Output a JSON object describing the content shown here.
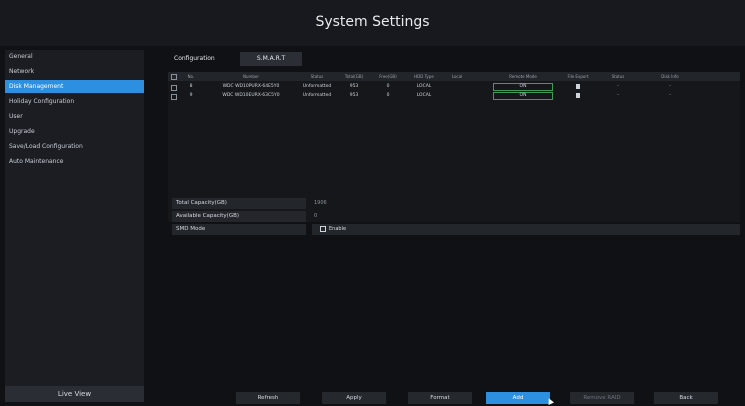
{
  "window": {
    "title": "System Settings"
  },
  "sidebar": {
    "items": [
      {
        "label": "General",
        "active": false
      },
      {
        "label": "Network",
        "active": false
      },
      {
        "label": "Disk Management",
        "active": true
      },
      {
        "label": "Holiday Configuration",
        "active": false
      },
      {
        "label": "User",
        "active": false
      },
      {
        "label": "Upgrade",
        "active": false
      },
      {
        "label": "Save/Load Configuration",
        "active": false
      },
      {
        "label": "Auto Maintenance",
        "active": false
      }
    ],
    "live_view_label": "Live View"
  },
  "tabs": [
    {
      "label": "Configuration"
    },
    {
      "label": "S.M.A.R.T"
    }
  ],
  "disk_table": {
    "headers": [
      "No.",
      "Number",
      "Status",
      "Total(GB)",
      "Free(GB)",
      "HDD Type",
      "Local",
      "Remote Mode",
      "File Export",
      "Status",
      "Disk Info"
    ],
    "rows": [
      {
        "no": "8",
        "number": "WDC WD10PURX-64E5Y0",
        "status": "Unformatted",
        "total": "953",
        "free": "0",
        "type": "LOCAL",
        "remote_mode": "ON",
        "disk_status": "-",
        "info": "-"
      },
      {
        "no": "9",
        "number": "WDC WD10EURX-63C5Y0",
        "status": "Unformatted",
        "total": "953",
        "free": "0",
        "type": "LOCAL",
        "remote_mode": "ON",
        "disk_status": "-",
        "info": "-"
      }
    ]
  },
  "capacity": {
    "total_label": "Total Capacity(GB)",
    "total_value": "1906",
    "available_label": "Available Capacity(GB)",
    "available_value": "0",
    "mode_label": "SMD Mode",
    "mode_value": "Enable"
  },
  "footer": {
    "refresh": "Refresh",
    "apply": "Apply",
    "format": "Format",
    "add": "Add",
    "remove": "Remove RAID",
    "back": "Back"
  },
  "colors": {
    "accent": "#2d8fe0",
    "remote_border": "#3e9b5b"
  }
}
